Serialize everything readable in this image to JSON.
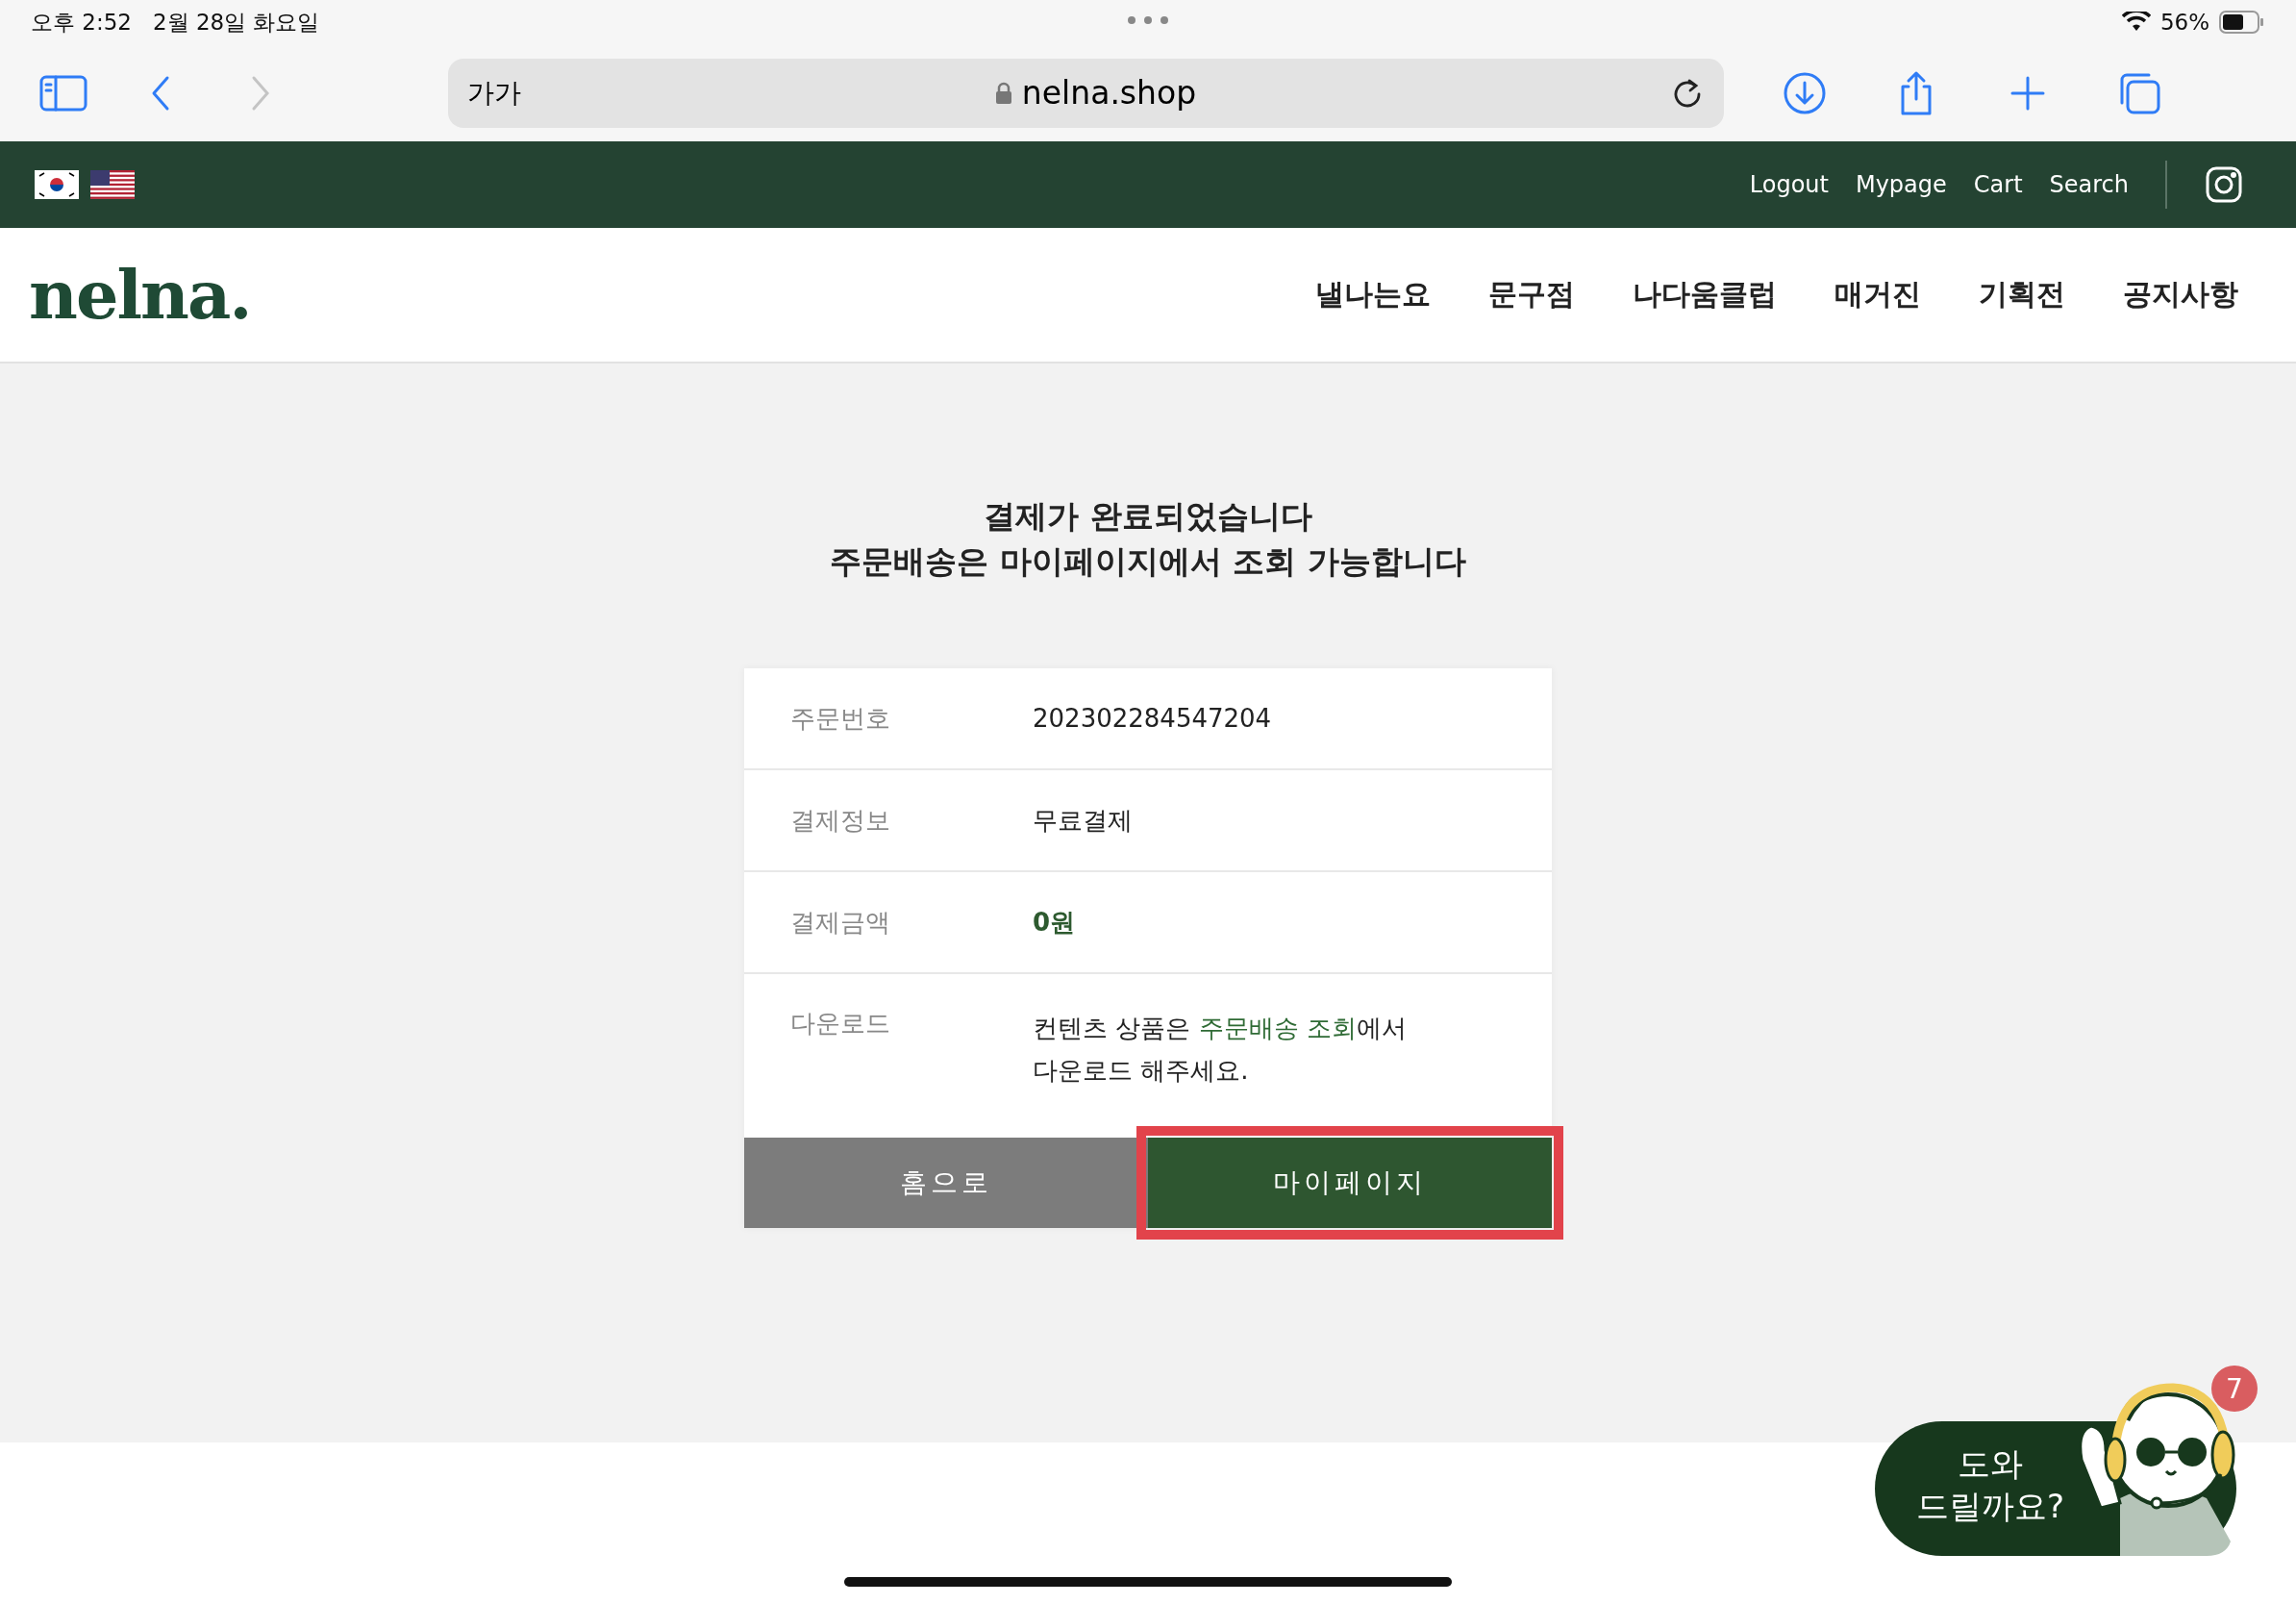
{
  "status_bar": {
    "time": "오후 2:52",
    "date": "2월 28일 화요일",
    "battery": "56%"
  },
  "browser": {
    "text_size": "가가",
    "url": "nelna.shop"
  },
  "top_bar": {
    "links": [
      "Logout",
      "Mypage",
      "Cart",
      "Search"
    ]
  },
  "header": {
    "logo": "nelna.",
    "nav": [
      "낼나는요",
      "문구점",
      "나다움클럽",
      "매거진",
      "기획전",
      "공지사항"
    ]
  },
  "message": [
    "결제가 완료되었습니다",
    "주문배송은 마이페이지에서 조회 가능합니다"
  ],
  "order": {
    "rows": [
      {
        "kind": "plain",
        "label": "주문번호",
        "value": "202302284547204"
      },
      {
        "kind": "plain",
        "label": "결제정보",
        "value": "무료결제"
      },
      {
        "kind": "amount",
        "label": "결제금액",
        "value": "0원"
      },
      {
        "kind": "link",
        "label": "다운로드",
        "value": "컨텐츠 상품은 ",
        "link": "주문배송 조회",
        "after": "에서 다운로드 해주세요."
      }
    ]
  },
  "buttons": [
    {
      "kind": "secondary",
      "label": "홈으로",
      "highlighted": false
    },
    {
      "kind": "primary",
      "label": "마이페이지",
      "highlighted": true
    }
  ],
  "chat": {
    "lines": [
      "도와",
      "드릴까요?"
    ],
    "badge": "7"
  }
}
